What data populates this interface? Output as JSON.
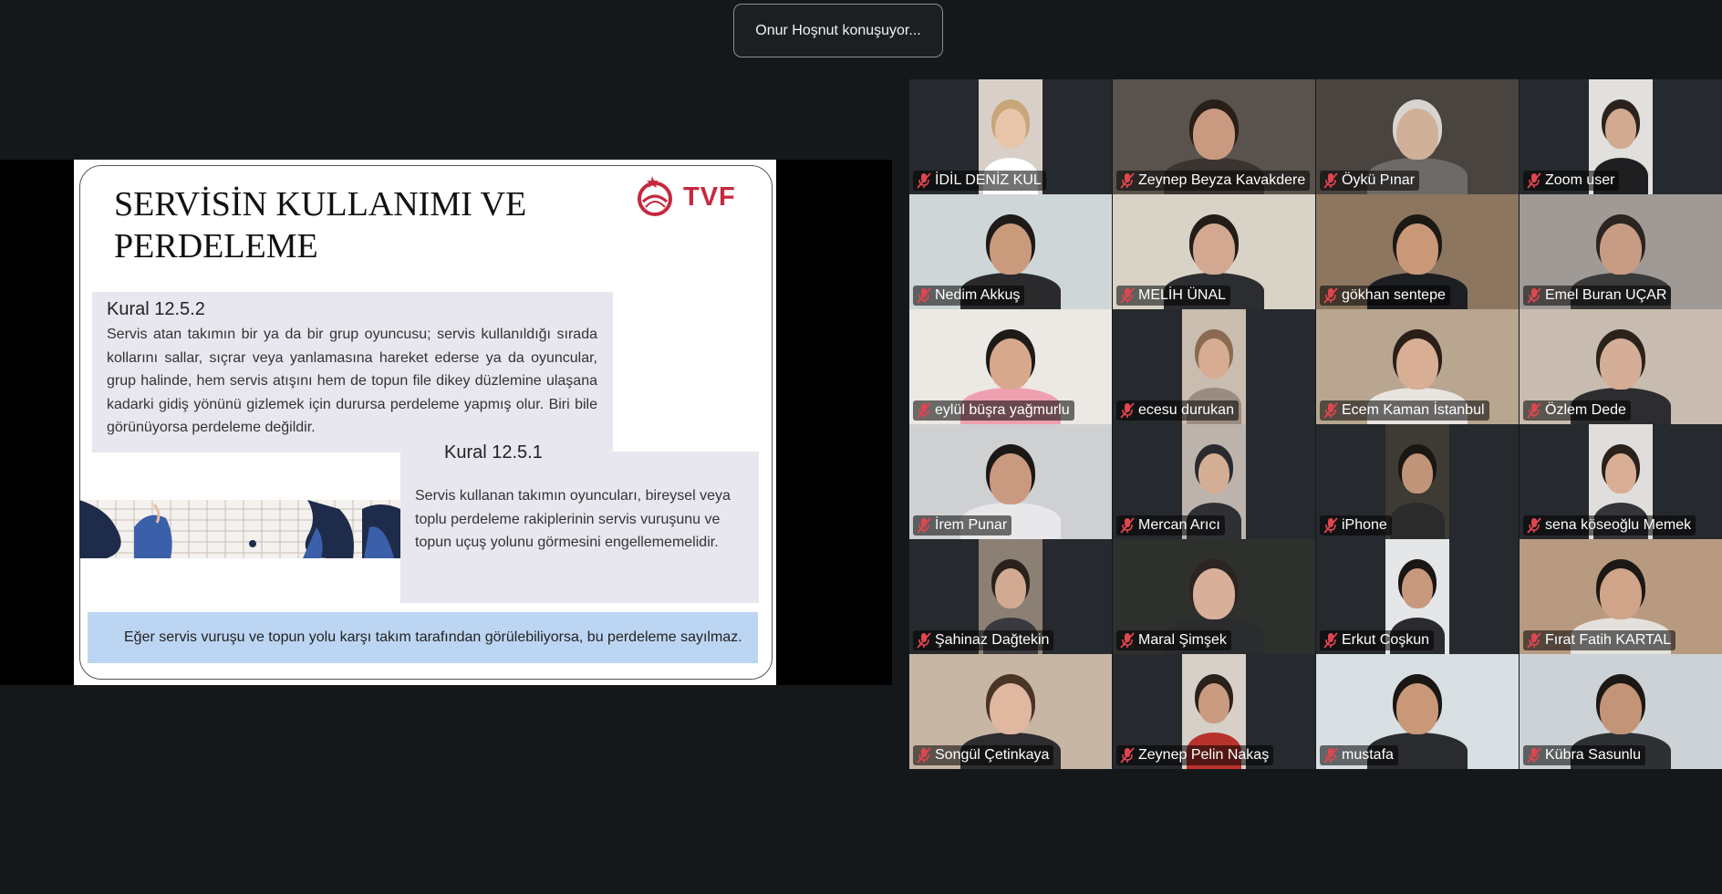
{
  "speaker_indicator": "Onur Hoşnut konuşuyor...",
  "slide": {
    "title": "SERVİSİN KULLANIMI VE PERDELEME",
    "logo_text": "TVF",
    "rule1": {
      "heading": "Kural 12.5.2",
      "text": "Servis atan takımın bir ya da bir grup oyuncusu; servis kullanıldığı sırada kollarını sallar, sıçrar veya yanlamasına hareket ederse ya da oyuncular, grup halinde, hem servis atışını hem de topun file dikey düzlemine ulaşana kadarki gidiş yönünü gizlemek için durursa perdeleme yapmış olur. Biri bile görünüyorsa perdeleme değildir."
    },
    "rule2": {
      "heading": "Kural 12.5.1",
      "text": "Servis kullanan takımın oyuncuları, bireysel veya toplu perdeleme rakiplerinin servis vuruşunu ve topun uçuş yolunu görmesini engellememelidir."
    },
    "note": "Eğer servis vuruşu ve topun yolu karşı takım tarafından görülebiliyorsa, bu perdeleme sayılmaz."
  },
  "participants": [
    {
      "name": "İDİL DENİZ KUL",
      "muted": true,
      "bg": "#d8d0c8",
      "skin": "#e8c4a8",
      "hair": "#c9a57a",
      "shirt": "#ffffff",
      "narrow": true
    },
    {
      "name": "Zeynep Beyza Kavakdere",
      "muted": true,
      "bg": "#5a524c",
      "skin": "#c99a80",
      "hair": "#2a1e18",
      "shirt": "#3a3330",
      "narrow": false
    },
    {
      "name": "Öykü Pınar",
      "muted": true,
      "bg": "#4a4440",
      "skin": "#d0b098",
      "hair": "#d8d4d0",
      "shirt": "#6d6a68",
      "narrow": false
    },
    {
      "name": "Zoom user",
      "muted": true,
      "bg": "#e2e0dc",
      "skin": "#d2aa90",
      "hair": "#2b2220",
      "shirt": "#1f1f22",
      "narrow": true
    },
    {
      "name": "Nedim Akkuş",
      "muted": true,
      "bg": "#cfd6d8",
      "skin": "#c99a7c",
      "hair": "#1e1a18",
      "shirt": "#2a2a2c",
      "narrow": false
    },
    {
      "name": "MELİH ÜNAL",
      "muted": true,
      "bg": "#d8d3c6",
      "skin": "#d2a890",
      "hair": "#231c18",
      "shirt": "#2b2d30",
      "narrow": false
    },
    {
      "name": "gökhan sentepe",
      "muted": true,
      "bg": "#8c7660",
      "skin": "#c89878",
      "hair": "#1c1814",
      "shirt": "#1c1e22",
      "narrow": false
    },
    {
      "name": "Emel Buran UÇAR",
      "muted": true,
      "bg": "#a09a96",
      "skin": "#c89c84",
      "hair": "#2b2420",
      "shirt": "#3b3a3a",
      "narrow": false
    },
    {
      "name": "eylül büşra yağmurlu",
      "muted": true,
      "bg": "#ece8e4",
      "skin": "#d8a88c",
      "hair": "#1e1a18",
      "shirt": "#ee9fb0",
      "narrow": false
    },
    {
      "name": "ecesu durukan",
      "muted": true,
      "bg": "#c9bdb0",
      "skin": "#d6ad92",
      "hair": "#8a6a50",
      "shirt": "#9a8c82",
      "narrow": true
    },
    {
      "name": "Ecem Kaman İstanbul",
      "muted": true,
      "bg": "#b8a690",
      "skin": "#d8ae94",
      "hair": "#2a1e18",
      "shirt": "#e8e4e0",
      "narrow": false
    },
    {
      "name": "Özlem Dede",
      "muted": true,
      "bg": "#c8bcb0",
      "skin": "#d4ae96",
      "hair": "#2c221c",
      "shirt": "#2d2d30",
      "narrow": false
    },
    {
      "name": "İrem Punar",
      "muted": true,
      "bg": "#cfd0d2",
      "skin": "#c99a80",
      "hair": "#1c1816",
      "shirt": "#e8e8ea",
      "narrow": false
    },
    {
      "name": "Mercan Arıcı",
      "muted": true,
      "bg": "#bcb4ac",
      "skin": "#d4ae94",
      "hair": "#2a2a2e",
      "shirt": "#2f3034",
      "narrow": true
    },
    {
      "name": "iPhone",
      "muted": true,
      "bg": "#3e3a34",
      "skin": "#c09478",
      "hair": "#1a1614",
      "shirt": "#2b2b2b",
      "narrow": true
    },
    {
      "name": "sena köseoğlu Memek",
      "muted": true,
      "bg": "#e0dedc",
      "skin": "#d8ae94",
      "hair": "#2a201c",
      "shirt": "#34343a",
      "narrow": true
    },
    {
      "name": "Şahinaz Dağtekin",
      "muted": true,
      "bg": "#8c8074",
      "skin": "#d2aa92",
      "hair": "#2a211c",
      "shirt": "#3a3a3e",
      "narrow": true
    },
    {
      "name": "Maral Şimşek",
      "muted": true,
      "bg": "#2e302e",
      "skin": "#d8b09a",
      "hair": "#2c2420",
      "shirt": "#2b2c2e",
      "narrow": false
    },
    {
      "name": "Erkut Coşkun",
      "muted": true,
      "bg": "#e4e6e8",
      "skin": "#c8987c",
      "hair": "#1a1614",
      "shirt": "#2a2b2f",
      "narrow": true
    },
    {
      "name": "Fırat Fatih KARTAL",
      "muted": true,
      "bg": "#b89a80",
      "skin": "#d0a488",
      "hair": "#1c1816",
      "shirt": "#e4e0dc",
      "narrow": false
    },
    {
      "name": "Songül Çetinkaya",
      "muted": true,
      "bg": "#c8b6a4",
      "skin": "#e0b8a0",
      "hair": "#4a3426",
      "shirt": "#2d2d30",
      "narrow": false
    },
    {
      "name": "Zeynep Pelin Nakaş",
      "muted": true,
      "bg": "#d6d0c8",
      "skin": "#c99c80",
      "hair": "#2a201c",
      "shirt": "#b8322c",
      "narrow": true
    },
    {
      "name": "mustafa",
      "muted": true,
      "bg": "#d8e0e4",
      "skin": "#c89878",
      "hair": "#1a1614",
      "shirt": "#2a2b2f",
      "narrow": false
    },
    {
      "name": "Kübra Sasunlu",
      "muted": true,
      "bg": "#cdd2d6",
      "skin": "#c49478",
      "hair": "#1c1816",
      "shirt": "#2e3034",
      "narrow": false
    }
  ],
  "colors": {
    "muted_icon": "#e0454f",
    "tvf_red": "#c6283e",
    "note_bg": "#bcd5f2",
    "rule_bg": "#e8e7ef"
  }
}
